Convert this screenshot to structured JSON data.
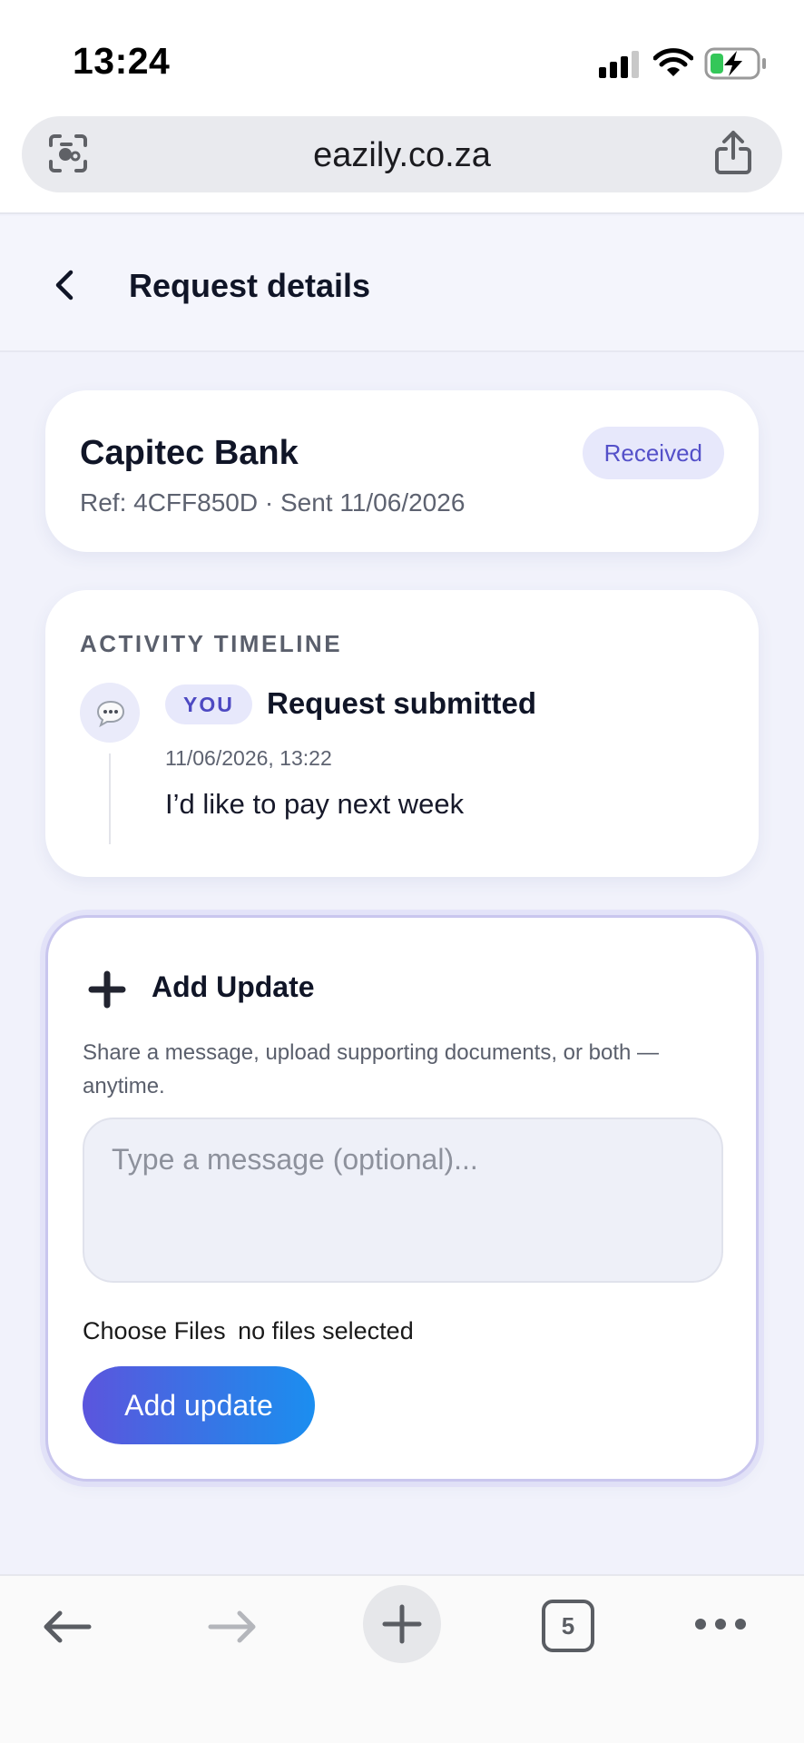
{
  "status_bar": {
    "time": "13:24"
  },
  "browser": {
    "url": "eazily.co.za"
  },
  "header": {
    "title": "Request details"
  },
  "request": {
    "bank_name": "Capitec Bank",
    "ref_line": "Ref: 4CFF850D · Sent 11/06/2026",
    "status": "Received"
  },
  "timeline": {
    "heading": "ACTIVITY TIMELINE",
    "events": [
      {
        "actor": "YOU",
        "title": "Request submitted",
        "timestamp": "11/06/2026, 13:22",
        "message": "I’d like to pay next week"
      }
    ]
  },
  "update_form": {
    "title": "Add Update",
    "description": "Share a message, upload supporting documents, or both — anytime.",
    "message_value": "",
    "message_placeholder": "Type a message (optional)...",
    "choose_files_label": "Choose Files",
    "file_status": "no files selected",
    "submit_label": "Add update"
  },
  "bottom_nav": {
    "tab_count": "5"
  },
  "colors": {
    "accent": "#5450c9",
    "badge_bg": "#e7e8fb",
    "button_gradient_start": "#5b55dd",
    "button_gradient_end": "#1b8ef0",
    "page_bg": "#f1f2fb"
  },
  "icons": {
    "url_left": "camera-scan-icon",
    "url_right": "share-icon",
    "back": "chevron-left-icon",
    "avatar": "speech-bubble-icon",
    "update": "plus-icon",
    "nav": [
      "arrow-left-icon",
      "arrow-right-icon",
      "plus-icon",
      "tabs-icon",
      "more-icon"
    ]
  }
}
